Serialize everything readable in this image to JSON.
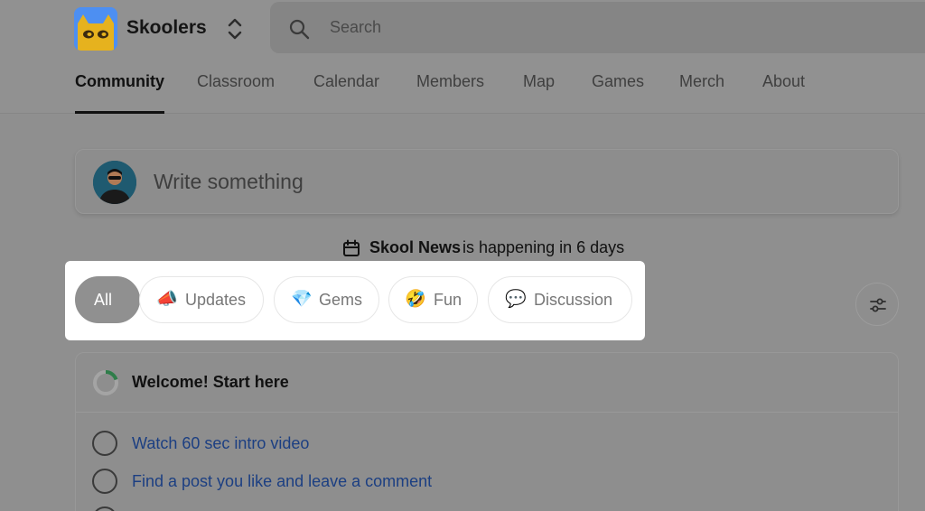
{
  "header": {
    "group_name": "Skoolers",
    "search_placeholder": "Search"
  },
  "tabs": [
    {
      "label": "Community",
      "active": true
    },
    {
      "label": "Classroom"
    },
    {
      "label": "Calendar"
    },
    {
      "label": "Members"
    },
    {
      "label": "Map"
    },
    {
      "label": "Games"
    },
    {
      "label": "Merch"
    },
    {
      "label": "About"
    }
  ],
  "composer": {
    "placeholder": "Write something"
  },
  "news": {
    "title": "Skool News",
    "rest": "is happening in 6 days"
  },
  "categories": [
    {
      "label": "All",
      "active": true
    },
    {
      "label": "Updates",
      "emoji": "📣",
      "icon": "megaphone-icon"
    },
    {
      "label": "Gems",
      "emoji": "💎",
      "icon": "gem-icon"
    },
    {
      "label": "Fun",
      "emoji": "🤣",
      "icon": "laughing-face-icon"
    },
    {
      "label": "Discussion",
      "emoji": "💬",
      "icon": "speech-bubble-icon"
    }
  ],
  "onboarding": {
    "title": "Welcome! Start here",
    "tasks": [
      {
        "label": "Watch 60 sec intro video",
        "done": false
      },
      {
        "label": "Find a post you like and leave a comment",
        "done": false
      }
    ]
  },
  "colors": {
    "overlay_gray": "#8f8f8f",
    "active_chip": "#909090",
    "link_blue": "#1c3f82",
    "progress_green": "#2f7d4a"
  }
}
